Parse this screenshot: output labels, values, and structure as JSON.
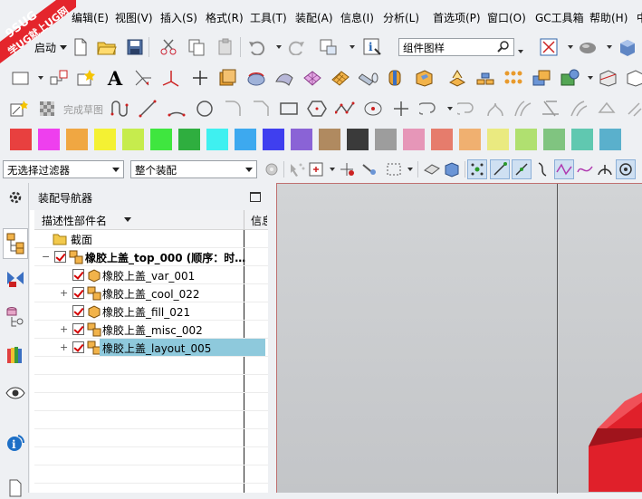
{
  "watermark": {
    "line1": "9SUG",
    "line2": "学UG就上UG网"
  },
  "menu": {
    "items": [
      "编辑(E)",
      "视图(V)",
      "插入(S)",
      "格式(R)",
      "工具(T)",
      "装配(A)",
      "信息(I)",
      "分析(L)",
      "首选项(P)",
      "窗口(O)",
      "GC工具箱",
      "帮助(H)",
      "中"
    ]
  },
  "toolbar1": {
    "start_label": "启动",
    "search_field": "组件图样"
  },
  "toolbar3": {
    "finish_sketch": "完成草图"
  },
  "palette": {
    "colors": [
      "#e8403f",
      "#ee3fee",
      "#f0a742",
      "#f4f133",
      "#c6ec4d",
      "#3fe63f",
      "#2fae3f",
      "#3ff0f0",
      "#3da9ef",
      "#3f3fef",
      "#8a63d6",
      "#b08a60",
      "#3a3a3a",
      "#9d9d9d",
      "#e696b8",
      "#e67c6c",
      "#f0b070",
      "#eaea80",
      "#b0e070",
      "#80c480",
      "#60c8b0",
      "#5ab0cc"
    ]
  },
  "filterbar": {
    "selection_filter": "无选择过滤器",
    "assembly_scope": "整个装配"
  },
  "navigator": {
    "title": "装配导航器",
    "column_name": "描述性部件名",
    "column_info": "信息",
    "rows": [
      {
        "label": "截面",
        "expander": ""
      },
      {
        "label": "橡胶上盖_top_000 (顺序：时…",
        "expander": "−"
      },
      {
        "label": "橡胶上盖_var_001",
        "expander": ""
      },
      {
        "label": "橡胶上盖_cool_022",
        "expander": "+"
      },
      {
        "label": "橡胶上盖_fill_021",
        "expander": ""
      },
      {
        "label": "橡胶上盖_misc_002",
        "expander": "+"
      },
      {
        "label": "橡胶上盖_layout_005",
        "expander": "+"
      }
    ]
  },
  "colors": {
    "accent_selection": "#8ec9dc",
    "part_red": "#e0202a"
  }
}
